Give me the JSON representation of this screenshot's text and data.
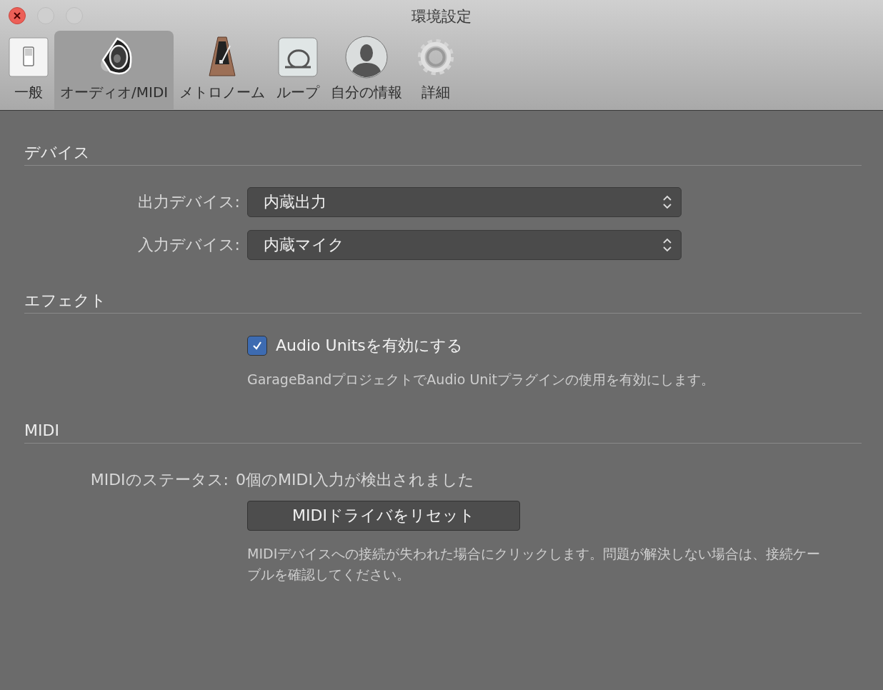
{
  "window": {
    "title": "環境設定"
  },
  "toolbar": [
    {
      "label": "一般",
      "kind": "switch",
      "selected": false
    },
    {
      "label": "オーディオ/MIDI",
      "kind": "speaker",
      "selected": true
    },
    {
      "label": "メトロノーム",
      "kind": "metronome",
      "selected": false
    },
    {
      "label": "ループ",
      "kind": "loop",
      "selected": false
    },
    {
      "label": "自分の情報",
      "kind": "person",
      "selected": false
    },
    {
      "label": "詳細",
      "kind": "gear",
      "selected": false
    }
  ],
  "sections": [
    {
      "title": "デバイス",
      "rows": [
        {
          "kind": "popup",
          "label": "出力デバイス:",
          "value": "内蔵出力"
        },
        {
          "kind": "popup",
          "label": "入力デバイス:",
          "value": "内蔵マイク"
        }
      ]
    },
    {
      "title": "エフェクト",
      "rows": [
        {
          "kind": "checkbox",
          "label": "Audio Unitsを有効にする",
          "checked": true
        },
        {
          "kind": "note",
          "text": "GarageBandプロジェクトでAudio Unitプラグインの使用を有効にします。"
        }
      ]
    },
    {
      "title": "MIDI",
      "rows": [
        {
          "kind": "status",
          "label": "MIDIのステータス:",
          "value": "0個のMIDI入力が検出されました"
        },
        {
          "kind": "button",
          "label": "MIDIドライバをリセット"
        },
        {
          "kind": "note",
          "text": "MIDIデバイスへの接続が失われた場合にクリックします。問題が解決しない場合は、接続ケーブルを確認してください。"
        }
      ]
    }
  ]
}
